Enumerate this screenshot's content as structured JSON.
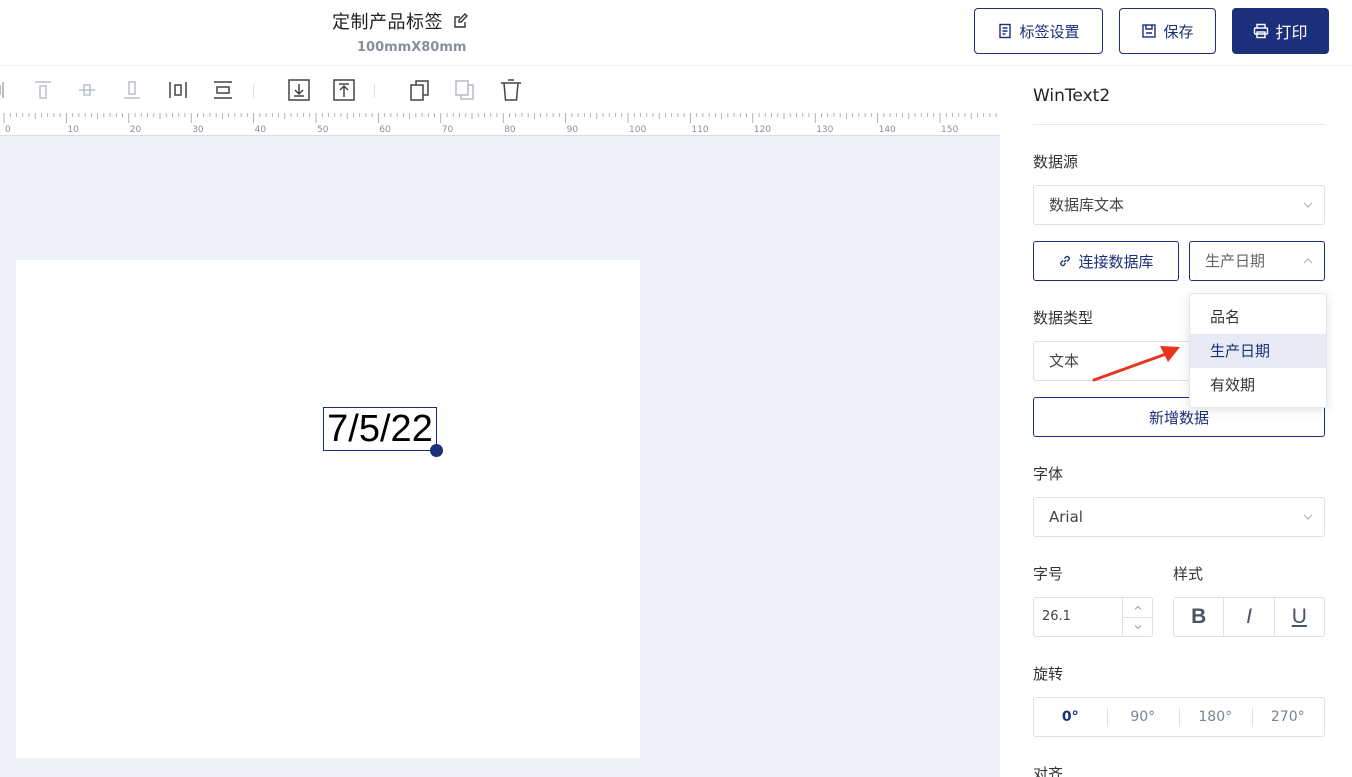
{
  "header": {
    "title": "定制产品标签",
    "size": "100mmX80mm",
    "buttons": {
      "label_settings": "标签设置",
      "save": "保存",
      "print": "打印"
    }
  },
  "toolbar": {
    "tools": [
      "align-left-icon",
      "align-top-icon",
      "align-vertical-center-icon",
      "align-bottom-icon",
      "distribute-horizontal-icon",
      "distribute-vertical-icon",
      "move-down-layer-icon",
      "move-up-layer-icon",
      "copy-icon",
      "paste-icon",
      "delete-icon"
    ]
  },
  "ruler": {
    "labels": [
      "0",
      "10",
      "20",
      "30",
      "40",
      "50",
      "60",
      "70",
      "80",
      "90",
      "100",
      "110",
      "120",
      "130",
      "140",
      "150"
    ]
  },
  "canvas": {
    "element_text": "7/5/22"
  },
  "panel": {
    "title": "WinText2",
    "data_source_label": "数据源",
    "data_source_value": "数据库文本",
    "connect_db_label": "连接数据库",
    "field_value": "生产日期",
    "field_options": [
      "品名",
      "生产日期",
      "有效期"
    ],
    "field_selected_index": 1,
    "data_type_label": "数据类型",
    "data_type_value": "文本",
    "add_data_label": "新增数据",
    "font_label": "字体",
    "font_value": "Arial",
    "font_size_label": "字号",
    "font_size_value": "26.1",
    "style_label": "样式",
    "style_buttons": [
      "B",
      "I",
      "U"
    ],
    "rotation_label": "旋转",
    "rotation_options": [
      "0°",
      "90°",
      "180°",
      "270°"
    ],
    "rotation_selected_index": 0,
    "align_label": "对齐"
  },
  "colors": {
    "accent": "#1b2f7a",
    "canvas_bg": "#eef2f6",
    "annotation_arrow": "#e8341c"
  }
}
